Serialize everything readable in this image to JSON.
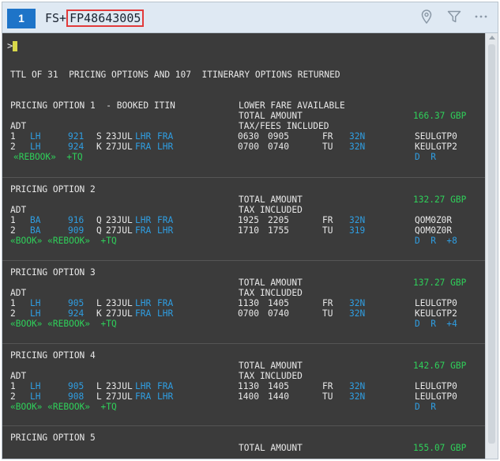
{
  "tab": {
    "number": "1"
  },
  "command": {
    "prefix": "FS+",
    "code": "FP48643005"
  },
  "header_icons": [
    "pin-icon",
    "filter-icon",
    "more-icon"
  ],
  "terminal": {
    "prompt": ">",
    "summary": "TTL OF 31  PRICING OPTIONS AND 107  ITINERARY OPTIONS RETURNED",
    "options": [
      {
        "title": "PRICING OPTION 1  - BOOKED ITIN",
        "note": "LOWER FARE AVAILABLE",
        "total_label": "TOTAL AMOUNT",
        "amount": "166.37 GBP",
        "pax": "ADT",
        "tax_label": "TAX/FEES INCLUDED",
        "segments": [
          {
            "n": "1",
            "airline": "LH",
            "flight": "921",
            "cls": "S",
            "date": "23JUL",
            "from": "LHR",
            "to": "FRA",
            "dep": "0630",
            "arr": "0905",
            "day": "FR",
            "equip": "32N",
            "fare": "SEULGTP0"
          },
          {
            "n": "2",
            "airline": "LH",
            "flight": "924",
            "cls": "K",
            "date": "27JUL",
            "from": "FRA",
            "to": "LHR",
            "dep": "0700",
            "arr": "0740",
            "day": "TU",
            "equip": "32N",
            "fare": "KEULGTP2"
          }
        ],
        "actions": "«REBOOK»  +TQ",
        "flags": "D  R"
      },
      {
        "title": "PRICING OPTION 2",
        "note": "",
        "total_label": "TOTAL AMOUNT",
        "amount": "132.27 GBP",
        "pax": "ADT",
        "tax_label": "TAX INCLUDED",
        "segments": [
          {
            "n": "1",
            "airline": "BA",
            "flight": "916",
            "cls": "Q",
            "date": "23JUL",
            "from": "LHR",
            "to": "FRA",
            "dep": "1925",
            "arr": "2205",
            "day": "FR",
            "equip": "32N",
            "fare": "QOM0Z0R"
          },
          {
            "n": "2",
            "airline": "BA",
            "flight": "909",
            "cls": "Q",
            "date": "27JUL",
            "from": "FRA",
            "to": "LHR",
            "dep": "1710",
            "arr": "1755",
            "day": "TU",
            "equip": "319",
            "fare": "QOM0Z0R"
          }
        ],
        "actions": "«BOOK» «REBOOK»  +TQ",
        "flags": "D  R  +8"
      },
      {
        "title": "PRICING OPTION 3",
        "note": "",
        "total_label": "TOTAL AMOUNT",
        "amount": "137.27 GBP",
        "pax": "ADT",
        "tax_label": "TAX INCLUDED",
        "segments": [
          {
            "n": "1",
            "airline": "LH",
            "flight": "905",
            "cls": "L",
            "date": "23JUL",
            "from": "LHR",
            "to": "FRA",
            "dep": "1130",
            "arr": "1405",
            "day": "FR",
            "equip": "32N",
            "fare": "LEULGTP0"
          },
          {
            "n": "2",
            "airline": "LH",
            "flight": "924",
            "cls": "K",
            "date": "27JUL",
            "from": "FRA",
            "to": "LHR",
            "dep": "0700",
            "arr": "0740",
            "day": "TU",
            "equip": "32N",
            "fare": "KEULGTP2"
          }
        ],
        "actions": "«BOOK» «REBOOK»  +TQ",
        "flags": "D  R  +4"
      },
      {
        "title": "PRICING OPTION 4",
        "note": "",
        "total_label": "TOTAL AMOUNT",
        "amount": "142.67 GBP",
        "pax": "ADT",
        "tax_label": "TAX INCLUDED",
        "segments": [
          {
            "n": "1",
            "airline": "LH",
            "flight": "905",
            "cls": "L",
            "date": "23JUL",
            "from": "LHR",
            "to": "FRA",
            "dep": "1130",
            "arr": "1405",
            "day": "FR",
            "equip": "32N",
            "fare": "LEULGTP0"
          },
          {
            "n": "2",
            "airline": "LH",
            "flight": "908",
            "cls": "L",
            "date": "27JUL",
            "from": "FRA",
            "to": "LHR",
            "dep": "1400",
            "arr": "1440",
            "day": "TU",
            "equip": "32N",
            "fare": "LEULGTP0"
          }
        ],
        "actions": "«BOOK» «REBOOK»  +TQ",
        "flags": "D  R"
      },
      {
        "title": "PRICING OPTION 5",
        "note": "",
        "total_label": "TOTAL AMOUNT",
        "amount": "155.07 GBP",
        "pax": "",
        "tax_label": "",
        "segments": [],
        "actions": "",
        "flags": ""
      }
    ]
  },
  "colors": {
    "accent": "#1e74c8",
    "link": "#2f9ee2",
    "green": "#2fd05a",
    "highlight_border": "#e23b3b",
    "terminal_bg": "#3b3b3b"
  }
}
